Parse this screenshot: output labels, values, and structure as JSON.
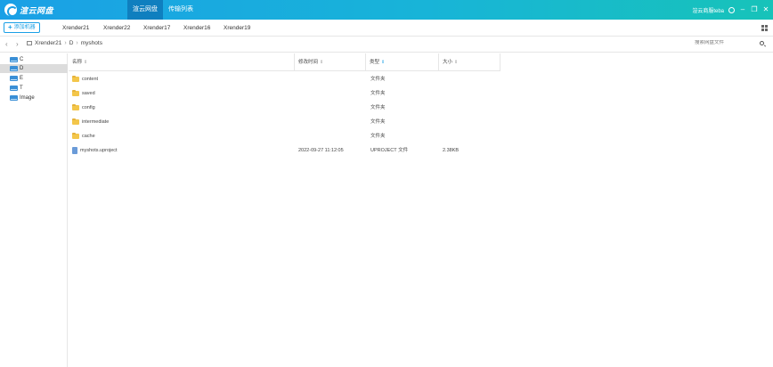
{
  "app": {
    "logo_text": "渲云网盘",
    "top_tabs": [
      "渲云网盘",
      "传输列表"
    ],
    "user": "渲云商服teba"
  },
  "toolbar": {
    "add_machine_label": "添加机器",
    "machines": [
      "Xrender21",
      "Xrender22",
      "Xrender17",
      "Xrender16",
      "Xrender19"
    ]
  },
  "path": {
    "crumbs": [
      "Xrender21",
      "D",
      "myshots"
    ],
    "search_placeholder": "搜索网盘文件"
  },
  "sidebar": {
    "drives": [
      "C",
      "D",
      "E",
      "T",
      "Image"
    ],
    "selected": "D"
  },
  "columns": {
    "name": "名称",
    "modified": "修改时间",
    "type": "类型",
    "size": "大小"
  },
  "files": [
    {
      "name": "content",
      "modified": "",
      "type": "文件夹",
      "size": "",
      "icon": "folder-icon"
    },
    {
      "name": "saved",
      "modified": "",
      "type": "文件夹",
      "size": "",
      "icon": "folder-icon"
    },
    {
      "name": "config",
      "modified": "",
      "type": "文件夹",
      "size": "",
      "icon": "folder-icon"
    },
    {
      "name": "intermediate",
      "modified": "",
      "type": "文件夹",
      "size": "",
      "icon": "folder-icon"
    },
    {
      "name": "cache",
      "modified": "",
      "type": "文件夹",
      "size": "",
      "icon": "folder-icon"
    },
    {
      "name": "myshots.uproject",
      "modified": "2022-09-27 11:12:05",
      "type": "UPROJECT 文件",
      "size": "2.38KB",
      "icon": "file-icon"
    }
  ],
  "colors": {
    "accent": "#1aa0e6",
    "header_gradient_end": "#17c3b9",
    "folder": "#f3c64a"
  }
}
